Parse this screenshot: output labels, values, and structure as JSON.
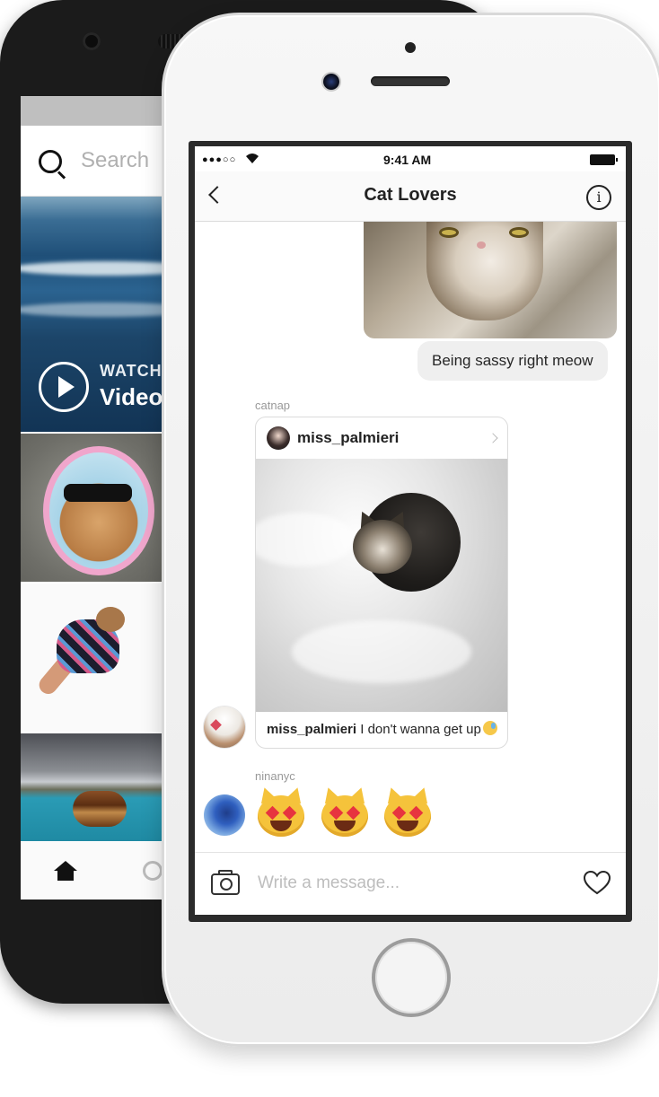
{
  "back_phone": {
    "search_placeholder": "Search",
    "watch_label": "WATCH",
    "video_label": "Video"
  },
  "front_phone": {
    "status_bar": {
      "signal": "●●●○○",
      "time": "9:41 AM"
    },
    "header": {
      "title": "Cat Lovers"
    },
    "messages": {
      "sassy_text": "Being sassy right meow",
      "shared_post": {
        "sender": "catnap",
        "author": "miss_palmieri",
        "caption_author": "miss_palmieri",
        "caption_text": " I don't wanna get up"
      },
      "emoji_message": {
        "sender": "ninanyc"
      }
    },
    "composer": {
      "placeholder": "Write a message..."
    }
  },
  "colors": {
    "bubble_gray": "#efefef",
    "meta_gray": "#999999",
    "accent_heart": "#e7343f"
  },
  "icons": [
    "search-icon",
    "play-icon",
    "home-icon",
    "back-chevron-icon",
    "info-icon",
    "chevron-right-icon",
    "camera-icon",
    "heart-icon",
    "wifi-icon",
    "battery-icon"
  ]
}
